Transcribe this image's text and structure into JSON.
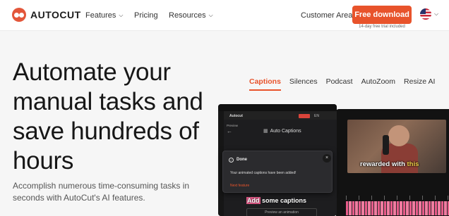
{
  "header": {
    "logo_text": "AUTOCUT",
    "nav": [
      {
        "label": "Features",
        "has_dropdown": true
      },
      {
        "label": "Pricing",
        "has_dropdown": false
      },
      {
        "label": "Resources",
        "has_dropdown": true
      }
    ],
    "customer_area": "Customer Area",
    "cta_label": "Free download",
    "cta_sub": "14-day free trial included",
    "language_flag": "us-flag-icon"
  },
  "hero": {
    "title_lines": [
      "Automate your",
      "manual tasks and",
      "save hundreds of",
      "hours"
    ],
    "subtitle_lines": [
      "Accomplish numerous time-consuming tasks in",
      "seconds with AutoCut's AI features."
    ]
  },
  "tabs": [
    {
      "label": "Captions",
      "active": true
    },
    {
      "label": "Silences",
      "active": false
    },
    {
      "label": "Podcast",
      "active": false
    },
    {
      "label": "AutoZoom",
      "active": false
    },
    {
      "label": "Resize AI",
      "active": false
    }
  ],
  "mockup": {
    "app_name": "Autocut",
    "language": "EN",
    "preview_label": "Preview",
    "panel_title": "Auto Captions",
    "video_caption_normal": "rewarded with",
    "video_caption_highlight": "this",
    "front_caption_prefix": "Add",
    "front_caption_rest": "some captions",
    "footer_label": "Preview an animation",
    "dialog": {
      "title": "Done",
      "message": "Your animated captions have been added!",
      "link": "Next feature"
    }
  },
  "colors": {
    "accent": "#e8532b",
    "text_dark": "#171717",
    "background": "#f6f6f6"
  }
}
